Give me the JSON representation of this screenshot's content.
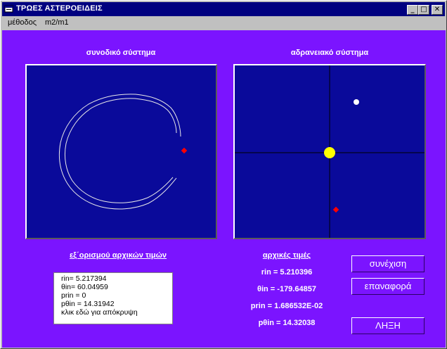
{
  "window": {
    "title": "ΤΡΩΕΣ ΑΣΤΕΡΟΕΙΔΕΙΣ"
  },
  "titlebar_buttons": {
    "minimize": "_",
    "maximize": "□",
    "close": "✕"
  },
  "menu": [
    "μέθοδος",
    "m2/m1"
  ],
  "left_panel": {
    "title": "συνοδικό σύστημα"
  },
  "right_panel": {
    "title": "αδρανειακό σύστημα"
  },
  "initial_values_link": "εξ΄ορισμού αρχικών τιμών",
  "info_lines": [
    "rin= 5.217394",
    "θin= 60.04959",
    "prin = 0",
    "pθin = 14.31942",
    "κλικ εδώ για απόκρυψη"
  ],
  "initial_values": {
    "title": "αρχικές τιμές",
    "rin": "rin = 5.210396",
    "thetain": "θin = -179.64857",
    "prin": "prin = 1.686532E-02",
    "pthetain": "pθin = 14.32038"
  },
  "buttons": {
    "continue": "συνέχιση",
    "reset": "επαναφορά",
    "end": "ΛΗΞΗ"
  },
  "colors": {
    "client_bg": "#7b14ff",
    "panel_bg": "#0a0a9a",
    "sun": "#ffff00",
    "asteroid": "#ff0000",
    "planet": "#ffffff",
    "titlebar": "#000080"
  }
}
